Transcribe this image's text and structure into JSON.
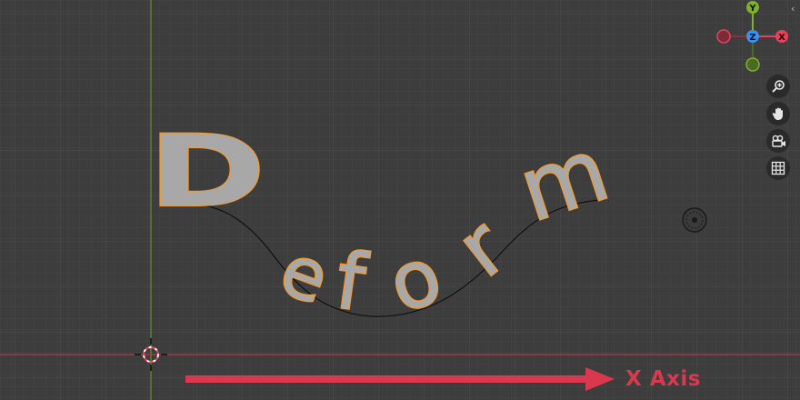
{
  "viewport": {
    "deform_text": "Deform",
    "annotation_label": "X Axis",
    "colors": {
      "background": "#3d3d3d",
      "x_axis": "#d9384f",
      "y_axis": "#6a8f2a",
      "selection_outline": "#f29a2e",
      "text_fill": "#a8a8a8"
    }
  },
  "gizmo": {
    "y_label": "Y",
    "z_label": "Z",
    "x_label": "X",
    "colors": {
      "x": "#e8405a",
      "y": "#7fb02c",
      "z": "#3b8ff0"
    }
  },
  "navigation": {
    "buttons": [
      {
        "icon": "zoom-icon"
      },
      {
        "icon": "hand-pan-icon"
      },
      {
        "icon": "camera-icon"
      },
      {
        "icon": "grid-icon"
      }
    ],
    "collapse_glyph": "‹"
  }
}
